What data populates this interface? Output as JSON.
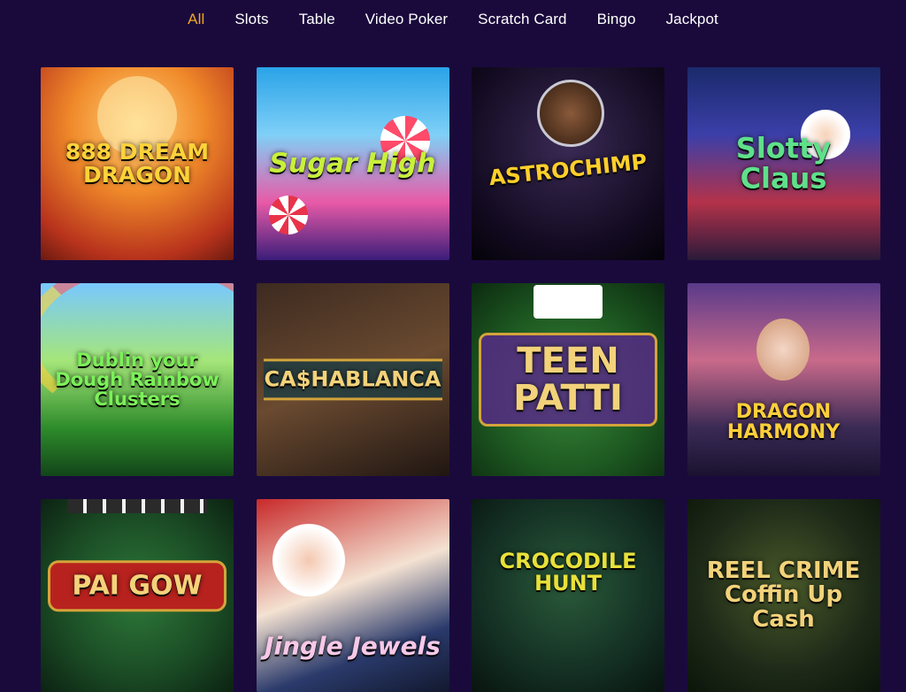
{
  "nav": {
    "items": [
      {
        "label": "All",
        "active": true
      },
      {
        "label": "Slots",
        "active": false
      },
      {
        "label": "Table",
        "active": false
      },
      {
        "label": "Video Poker",
        "active": false
      },
      {
        "label": "Scratch Card",
        "active": false
      },
      {
        "label": "Bingo",
        "active": false
      },
      {
        "label": "Jackpot",
        "active": false
      }
    ]
  },
  "games": [
    {
      "title": "888 DREAM DRAGON"
    },
    {
      "title": "Sugar High"
    },
    {
      "title": "ASTROCHIMP"
    },
    {
      "title": "Slotty Claus"
    },
    {
      "title": "Dublin your Dough Rainbow Clusters"
    },
    {
      "title": "CA$HABLANCA"
    },
    {
      "title": "TEEN PATTI"
    },
    {
      "title": "DRAGON HARMONY"
    },
    {
      "title": "PAI GOW"
    },
    {
      "title": "Jingle Jewels"
    },
    {
      "title": "CROCODILE HUNT"
    },
    {
      "title": "REEL CRIME Coffin Up Cash"
    }
  ],
  "colors": {
    "background": "#1a0a3c",
    "nav_active": "#f0a824",
    "nav_text": "#ffffff"
  }
}
